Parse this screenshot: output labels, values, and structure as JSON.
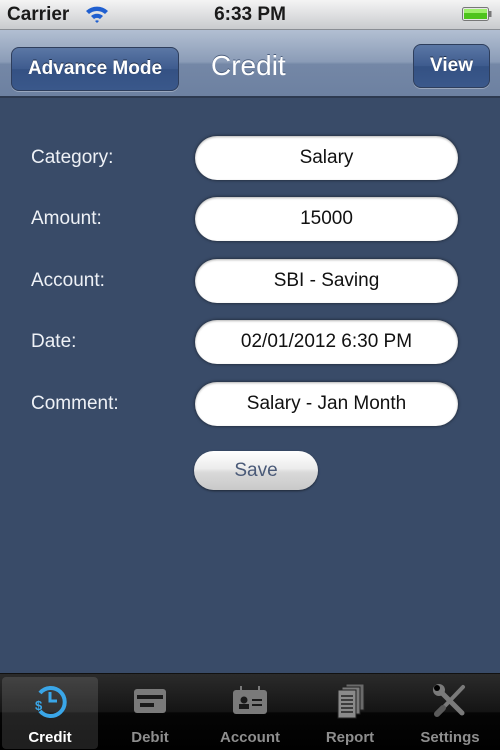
{
  "status_bar": {
    "carrier": "Carrier",
    "time": "6:33 PM",
    "wifi_icon": "wifi-icon",
    "battery_icon": "battery-full-icon"
  },
  "nav_bar": {
    "left_button": "Advance Mode",
    "title": "Credit",
    "right_button": "View"
  },
  "form": {
    "fields": [
      {
        "label": "Category:",
        "value": "Salary"
      },
      {
        "label": "Amount:",
        "value": "15000"
      },
      {
        "label": "Account:",
        "value": "SBI - Saving"
      },
      {
        "label": "Date:",
        "value": "02/01/2012 6:30 PM"
      },
      {
        "label": "Comment:",
        "value": "Salary - Jan Month"
      }
    ],
    "save_label": "Save"
  },
  "tab_bar": {
    "selected": "Credit",
    "tabs": [
      {
        "label": "Credit",
        "icon": "credit-clock-dollar-icon"
      },
      {
        "label": "Debit",
        "icon": "card-icon"
      },
      {
        "label": "Account",
        "icon": "contact-card-icon"
      },
      {
        "label": "Report",
        "icon": "documents-icon"
      },
      {
        "label": "Settings",
        "icon": "tools-icon"
      }
    ]
  },
  "colors": {
    "background": "#394b68",
    "tab_selected": "#3aa6e8"
  }
}
